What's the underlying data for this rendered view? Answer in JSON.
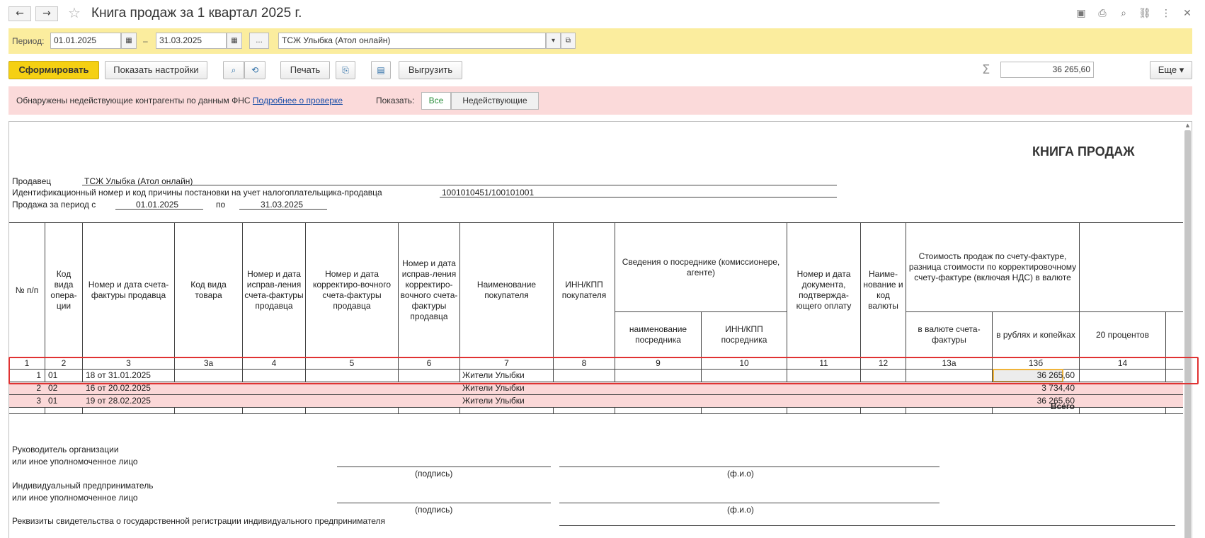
{
  "window": {
    "title": "Книга продаж за 1 квартал 2025 г."
  },
  "period": {
    "label": "Период:",
    "from": "01.01.2025",
    "dash": "–",
    "to": "31.03.2025",
    "dots": "...",
    "org": "ТСЖ Улыбка (Атол онлайн)"
  },
  "toolbar": {
    "generate": "Сформировать",
    "show_settings": "Показать настройки",
    "print": "Печать",
    "export": "Выгрузить",
    "sum_value": "36 265,60",
    "more": "Еще ▾"
  },
  "alert": {
    "text": "Обнаружены недействующие контрагенты по данным ФНС",
    "link": "Подробнее о проверке",
    "show_label": "Показать:",
    "seg_all": "Все",
    "seg_inactive": "Недействующие"
  },
  "report": {
    "heading": "КНИГА ПРОДАЖ",
    "seller_label": "Продавец",
    "seller": "ТСЖ Улыбка (Атол онлайн)",
    "inn_label": "Идентификационный номер и код причины постановки на учет налогоплательщика-продавца",
    "inn": "1001010451/100101001",
    "period_label": "Продажа за период с",
    "period_from": "01.01.2025",
    "period_to_label": "по",
    "period_to": "31.03.2025",
    "columns": [
      "№ п/п",
      "Код вида опера-ции",
      "Номер и дата счета-фактуры продавца",
      "Код вида товара",
      "Номер и дата исправ-ления счета-фактуры продавца",
      "Номер и дата корректиро-вочного счета-фактуры продавца",
      "Номер и дата исправ-ления корректиро-вочного счета-фактуры продавца",
      "Наименование покупателя",
      "ИНН/КПП покупателя",
      "Сведения о посреднике (комиссионере, агенте)",
      "Номер и дата документа, подтвержда-ющего оплату",
      "Наиме-нование и код валюты",
      "Стоимость продаж по счету-фактуре, разница стоимости по корректировочному счету-фактуре (включая НДС) в валюте",
      "наименование посредника",
      "ИНН/КПП посредника",
      "в валюте счета-фактуры",
      "в рублях и копейках",
      "20 процентов"
    ],
    "col_numbers": [
      "1",
      "2",
      "3",
      "3а",
      "4",
      "5",
      "6",
      "7",
      "8",
      "9",
      "10",
      "11",
      "12",
      "13а",
      "13б",
      "14"
    ],
    "rows": [
      {
        "n": "1",
        "op": "01",
        "invoice": "18 от 31.01.2025",
        "buyer": "Жители Улыбки",
        "sum": "36 265,60"
      },
      {
        "n": "2",
        "op": "02",
        "invoice": "16 от 20.02.2025",
        "buyer": "Жители Улыбки",
        "sum": "3 734,40"
      },
      {
        "n": "3",
        "op": "01",
        "invoice": "19 от 28.02.2025",
        "buyer": "Жители Улыбки",
        "sum": "36 265,60"
      }
    ],
    "total_label": "Всего",
    "sign1_a": "Руководитель организации",
    "sign1_b": "или иное уполномоченное лицо",
    "sign2_a": "Индивидуальный предприниматель",
    "sign2_b": "или иное уполномоченное лицо",
    "signature": "(подпись)",
    "fio": "(ф.и.о)",
    "requisites": "Реквизиты свидетельства о государственной регистрации индивидуального предпринимателя"
  }
}
